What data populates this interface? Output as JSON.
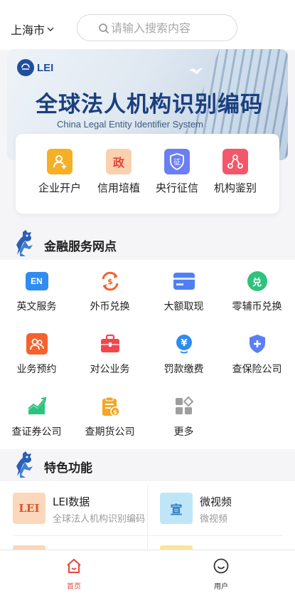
{
  "header": {
    "city": "上海市",
    "search_placeholder": "请输入搜索内容"
  },
  "banner": {
    "logo_text": "LEI",
    "title": "全球法人机构识别编码",
    "subtitle": "China Legal Entity Identifier System"
  },
  "quick_actions": [
    {
      "label": "企业开户",
      "icon": "person-add-icon",
      "color": "#f5a623"
    },
    {
      "label": "信用培植",
      "icon": "zheng-icon",
      "color": "#f7b089"
    },
    {
      "label": "央行征信",
      "icon": "shield-zheng-icon",
      "color": "#6a7ef5"
    },
    {
      "label": "机构鉴别",
      "icon": "network-icon",
      "color": "#f3576a"
    }
  ],
  "section_financial": {
    "title": "金融服务网点"
  },
  "services": [
    {
      "label": "英文服务",
      "icon": "en-icon",
      "color": "#2f8cf0"
    },
    {
      "label": "外币兑换",
      "icon": "currency-exchange-icon",
      "color": "#f5622d"
    },
    {
      "label": "大额取现",
      "icon": "card-icon",
      "color": "#4f7ff5"
    },
    {
      "label": "零辅币兑换",
      "icon": "coin-exchange-icon",
      "color": "#2ec27e"
    },
    {
      "label": "业务预约",
      "icon": "appointment-icon",
      "color": "#f5622d"
    },
    {
      "label": "对公业务",
      "icon": "briefcase-icon",
      "color": "#f0474f"
    },
    {
      "label": "罚款缴费",
      "icon": "yuan-icon",
      "color": "#2f8cf0"
    },
    {
      "label": "查保险公司",
      "icon": "shield-plus-icon",
      "color": "#5a7ff5"
    },
    {
      "label": "查证券公司",
      "icon": "stock-chart-icon",
      "color": "#2ec27e"
    },
    {
      "label": "查期货公司",
      "icon": "futures-icon",
      "color": "#f5a623"
    },
    {
      "label": "更多",
      "icon": "more-grid-icon",
      "color": "#9e9e9e"
    }
  ],
  "section_features": {
    "title": "特色功能"
  },
  "features": [
    {
      "title": "LEI数据",
      "subtitle": "全球法人机构识别编码",
      "badge": "LEI"
    },
    {
      "title": "微视频",
      "subtitle": "微视频",
      "badge": "宣"
    }
  ],
  "tabbar": [
    {
      "label": "首页",
      "active": true
    },
    {
      "label": "用户",
      "active": false
    }
  ]
}
